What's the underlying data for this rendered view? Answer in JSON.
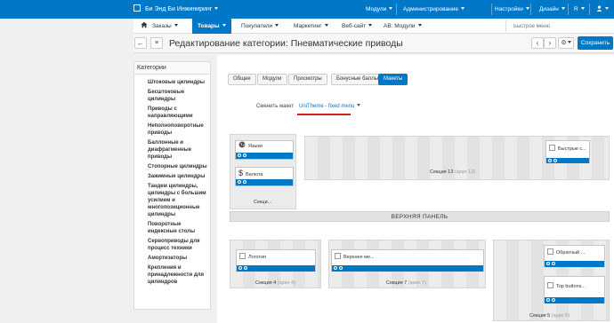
{
  "topbar": {
    "brand": "Би Энд Би Инжиниринг",
    "menu": [
      "Модули",
      "Администрирование",
      "Настройки",
      "Дизайн"
    ],
    "lang": "R"
  },
  "nav": {
    "items": [
      "Заказы",
      "Товары",
      "Покупатели",
      "Маркетинг",
      "Веб-сайт",
      "АВ: Модули"
    ],
    "search_placeholder": "Быстрое меню"
  },
  "page": {
    "title": "Редактирование категории: Пневматические приводы",
    "save": "Сохранить"
  },
  "sidebar": {
    "title": "Категории",
    "items": [
      "Штоковые цилиндры",
      "Бесштоковые цилиндры",
      "Приводы с направляющими",
      "Неполноповоротные приводы",
      "Баллонные и диафрагменные приводы",
      "Стопорные цилиндры",
      "Зажимные цилиндры",
      "Тандем цилиндры, цилиндры с большим усилием и многопозиционные цилиндры",
      "Поворотные индексные столы",
      "Сервоприводы для процесс техники",
      "Амортизаторы",
      "Крепления и принадлежности для цилиндров"
    ]
  },
  "tabs": [
    "Общее",
    "Модули",
    "Просмотры",
    "Бонусные баллы",
    "Макеты"
  ],
  "layout": {
    "change_label": "Сменить макет",
    "theme": "UniTheme - fixed menu"
  },
  "blocks": {
    "languages": "Языки",
    "currency": "Валюта",
    "quick": "Быстрые с...",
    "logo": "Логотип",
    "top_menu": "Верхнее ме...",
    "cart": "Обратный ...",
    "top_buttons": "Top buttons..."
  },
  "sections": {
    "sec_short": "Секци...",
    "sec13": "Секция 13",
    "sec13_span": "(span 13)",
    "top_panel": "ВЕРХНЯЯ ПАНЕЛЬ",
    "sec4": "Секция 4",
    "sec4_span": "(span 4)",
    "sec7": "Секция 7",
    "sec7_span": "(span 7)",
    "sec5": "Секция 5",
    "sec5_span": "(span 5)"
  },
  "colors": {
    "accent": "#0078c8",
    "underline": "#d42020"
  }
}
